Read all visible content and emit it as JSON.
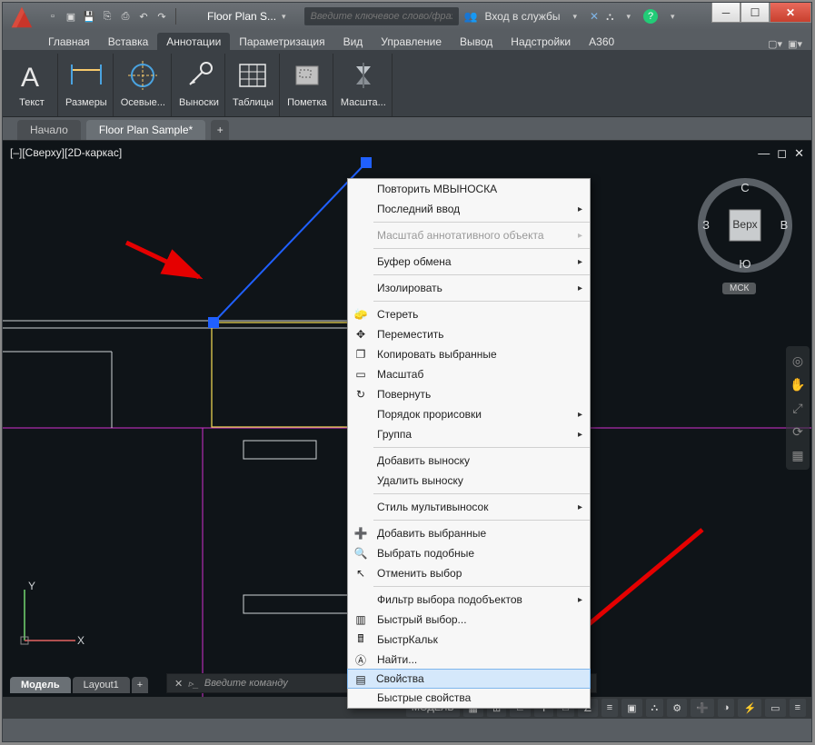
{
  "title": "Floor Plan S...",
  "search_placeholder": "Введите ключевое слово/фразу",
  "signin_label": "Вход в службы",
  "menu_tabs": [
    "Главная",
    "Вставка",
    "Аннотации",
    "Параметризация",
    "Вид",
    "Управление",
    "Вывод",
    "Надстройки",
    "A360"
  ],
  "menu_active_index": 2,
  "ribbon": [
    {
      "label": "Текст"
    },
    {
      "label": "Размеры"
    },
    {
      "label": "Осевые..."
    },
    {
      "label": "Выноски"
    },
    {
      "label": "Таблицы"
    },
    {
      "label": "Пометка"
    },
    {
      "label": "Масшта..."
    }
  ],
  "doc_tabs": {
    "inactive": "Начало",
    "active": "Floor Plan Sample*"
  },
  "view_label": "[–][Сверху][2D-каркас]",
  "viewcube": {
    "top": "С",
    "left": "З",
    "right": "В",
    "bottom": "Ю",
    "face": "Верх",
    "wcs": "МСК"
  },
  "cmd_placeholder": "Введите команду",
  "model_tabs": {
    "active": "Модель",
    "other": "Layout1"
  },
  "status": {
    "model": "МОДЕЛЬ"
  },
  "context_menu": {
    "repeat": "Повторить МВЫНОСКА",
    "last_input": "Последний ввод",
    "anno_scale": "Масштаб аннотативного объекта",
    "clipboard": "Буфер обмена",
    "isolate": "Изолировать",
    "erase": "Стереть",
    "move": "Переместить",
    "copy": "Копировать выбранные",
    "scale": "Масштаб",
    "rotate": "Повернуть",
    "draw_order": "Порядок прорисовки",
    "group": "Группа",
    "add_leader": "Добавить выноску",
    "del_leader": "Удалить выноску",
    "mleader_style": "Стиль мультивыносок",
    "add_selected": "Добавить выбранные",
    "select_similar": "Выбрать подобные",
    "deselect": "Отменить выбор",
    "subobj_filter": "Фильтр выбора подобъектов",
    "quick_select": "Быстрый выбор...",
    "quickcalc": "БыстрКальк",
    "find": "Найти...",
    "properties": "Свойства",
    "quick_props": "Быстрые свойства"
  }
}
